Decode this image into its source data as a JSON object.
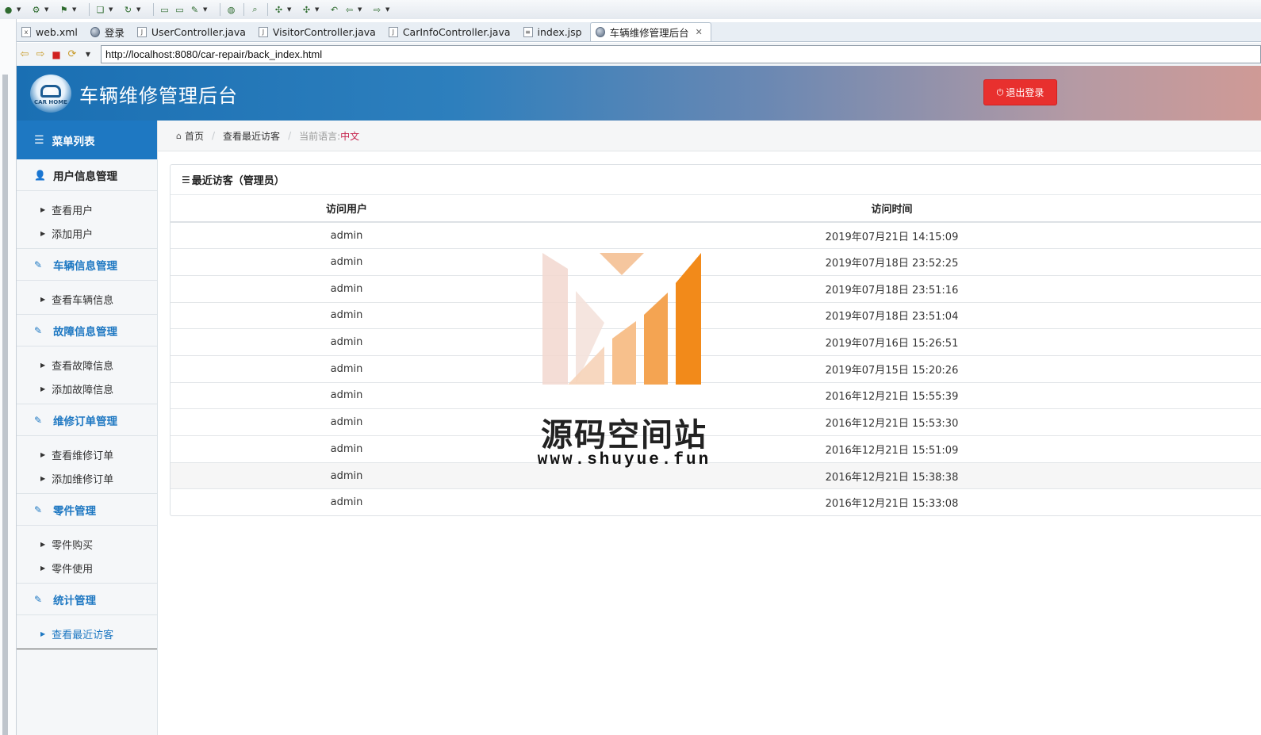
{
  "ide": {
    "tabs": [
      {
        "label": "web.xml",
        "icon": "xml-file-icon"
      },
      {
        "label": "登录",
        "icon": "globe-icon"
      },
      {
        "label": "UserController.java",
        "icon": "java-file-icon"
      },
      {
        "label": "VisitorController.java",
        "icon": "java-file-icon"
      },
      {
        "label": "CarInfoController.java",
        "icon": "java-file-icon"
      },
      {
        "label": "index.jsp",
        "icon": "jsp-file-icon"
      },
      {
        "label": "车辆维修管理后台",
        "icon": "globe-icon",
        "active": true
      }
    ],
    "url": "http://localhost:8080/car-repair/back_index.html"
  },
  "header": {
    "logo_text": "CAR HOME",
    "title": "车辆维修管理后台",
    "logout_label": "退出登录"
  },
  "sidebar": {
    "menu_title": "菜单列表",
    "groups": [
      {
        "label": "用户信息管理",
        "icon": "user-icon",
        "items": [
          "查看用户",
          "添加用户"
        ]
      },
      {
        "label": "车辆信息管理",
        "icon": "edit-icon",
        "items": [
          "查看车辆信息"
        ]
      },
      {
        "label": "故障信息管理",
        "icon": "edit-icon",
        "items": [
          "查看故障信息",
          "添加故障信息"
        ]
      },
      {
        "label": "维修订单管理",
        "icon": "edit-icon",
        "items": [
          "查看维修订单",
          "添加维修订单"
        ]
      },
      {
        "label": "零件管理",
        "icon": "edit-icon",
        "items": [
          "零件购买",
          "零件使用"
        ]
      },
      {
        "label": "统计管理",
        "icon": "edit-icon",
        "items": [
          "查看最近访客"
        ]
      }
    ]
  },
  "breadcrumb": {
    "home": "首页",
    "current": "查看最近访客",
    "lang_label": "当前语言:",
    "lang_value": "中文"
  },
  "panel": {
    "title": "最近访客（管理员）",
    "columns": [
      "访问用户",
      "访问时间"
    ],
    "rows": [
      [
        "admin",
        "2019年07月21日 14:15:09"
      ],
      [
        "admin",
        "2019年07月18日 23:52:25"
      ],
      [
        "admin",
        "2019年07月18日 23:51:16"
      ],
      [
        "admin",
        "2019年07月18日 23:51:04"
      ],
      [
        "admin",
        "2019年07月16日 15:26:51"
      ],
      [
        "admin",
        "2019年07月15日 15:20:26"
      ],
      [
        "admin",
        "2016年12月21日 15:55:39"
      ],
      [
        "admin",
        "2016年12月21日 15:53:30"
      ],
      [
        "admin",
        "2016年12月21日 15:51:09"
      ],
      [
        "admin",
        "2016年12月21日 15:38:38"
      ],
      [
        "admin",
        "2016年12月21日 15:33:08"
      ]
    ]
  },
  "watermark": {
    "title": "源码空间站",
    "url": "www.shuyue.fun"
  },
  "colors": {
    "primary": "#1e78c2",
    "danger": "#e8302e",
    "lang": "#c7254e",
    "watermark_orange": "#f28a1a"
  }
}
